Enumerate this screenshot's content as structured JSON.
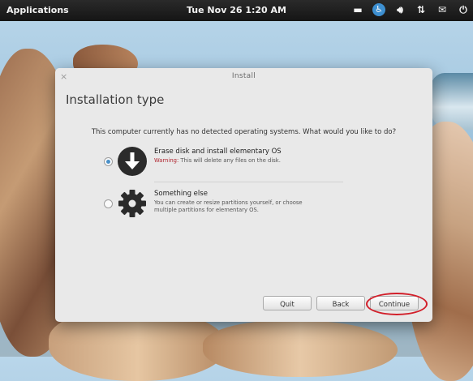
{
  "topbar": {
    "applications_label": "Applications",
    "clock": "Tue Nov 26  1:20 AM",
    "tray_icons": [
      "network-icon",
      "accessibility-icon",
      "volume-icon",
      "transfer-icon",
      "mail-icon",
      "power-icon"
    ]
  },
  "dialog": {
    "close_glyph": "×",
    "title": "Install",
    "heading": "Installation type",
    "question": "This computer currently has no detected operating systems. What would you like to do?",
    "options": [
      {
        "title": "Erase disk and install elementary OS",
        "warning_label": "Warning:",
        "description": " This will delete any files on the disk.",
        "selected": true,
        "icon": "download-arrow-icon"
      },
      {
        "title": "Something else",
        "description_line1": "You can create or resize partitions yourself, or choose",
        "description_line2": "multiple partitions for elementary OS.",
        "selected": false,
        "icon": "gear-icon"
      }
    ],
    "buttons": {
      "quit": "Quit",
      "back": "Back",
      "continue": "Continue"
    }
  },
  "colors": {
    "topbar": "#1e1e1e",
    "dialog_bg": "#e9e9e9",
    "radio_selected": "#4a90c8",
    "warning": "#b0252f",
    "annotation_ring": "#d21f2a"
  }
}
